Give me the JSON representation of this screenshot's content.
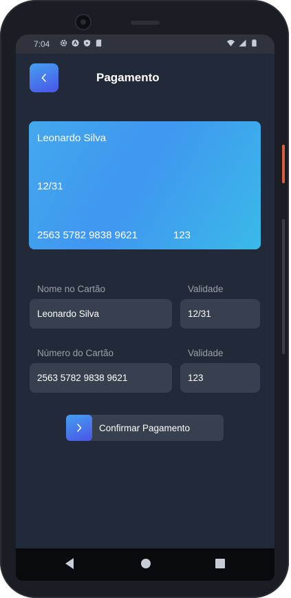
{
  "status_bar": {
    "time": "7:04",
    "left_icons": [
      "gear-icon",
      "autofill-icon",
      "play-protect-icon",
      "sd-card-icon"
    ],
    "right_icons": [
      "wifi-icon",
      "signal-icon",
      "battery-icon"
    ]
  },
  "header": {
    "back_icon": "chevron-left-icon",
    "title": "Pagamento"
  },
  "card_preview": {
    "name": "Leonardo Silva",
    "expiry": "12/31",
    "number": "2563 5782 9838 9621",
    "cvv": "123",
    "gradient": [
      "#43a8ee",
      "#3ab9e8"
    ]
  },
  "form": {
    "name_label": "Nome no Cartão",
    "name_value": "Leonardo Silva",
    "expiry_label": "Validade",
    "expiry_value": "12/31",
    "number_label": "Número do Cartão",
    "number_value": "2563 5782 9838 9621",
    "cvv_label": "Validade",
    "cvv_value": "123"
  },
  "confirm": {
    "icon": "chevron-right-icon",
    "label": "Confirmar Pagamento"
  },
  "nav_bar": {
    "items": [
      "back-triangle-icon",
      "home-circle-icon",
      "recents-square-icon"
    ]
  },
  "colors": {
    "background": "#222938",
    "field": "#37404f",
    "accent_start": "#45a0f0",
    "accent_end": "#4a54e8"
  }
}
